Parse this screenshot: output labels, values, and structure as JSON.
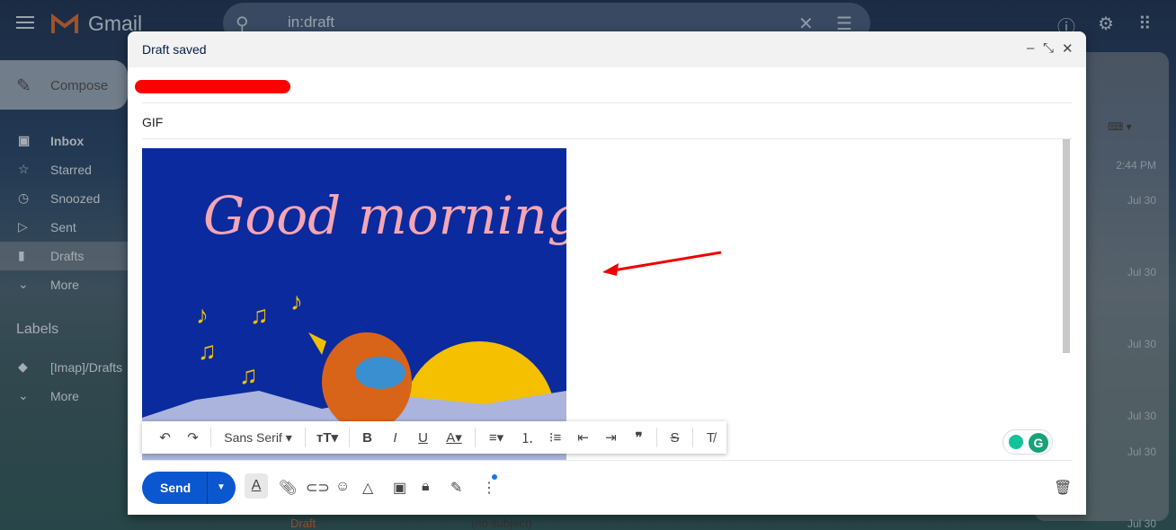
{
  "app": {
    "name": "Gmail",
    "search_value": "in:draft"
  },
  "sidebar": {
    "compose": "Compose",
    "items": [
      {
        "label": "Inbox",
        "icon": "inbox-icon"
      },
      {
        "label": "Starred",
        "icon": "star-icon"
      },
      {
        "label": "Snoozed",
        "icon": "clock-icon"
      },
      {
        "label": "Sent",
        "icon": "send-icon"
      },
      {
        "label": "Drafts",
        "icon": "draft-icon"
      },
      {
        "label": "More",
        "icon": "chevron-down-icon"
      }
    ],
    "labels_heading": "Labels",
    "labels": [
      {
        "label": "[Imap]/Drafts"
      },
      {
        "label": "More"
      }
    ]
  },
  "list": {
    "dates": [
      "2:44 PM",
      "Jul 30",
      "Jul 30",
      "Jul 30",
      "Jul 30",
      "Jul 30",
      "Jul 30"
    ],
    "bottom_row": {
      "status": "Draft",
      "subject": "(no subject)"
    }
  },
  "compose": {
    "title": "Draft saved",
    "subject": "GIF",
    "image_text": "Good morning",
    "toolbar": {
      "font": "Sans Serif"
    },
    "send": "Send"
  }
}
